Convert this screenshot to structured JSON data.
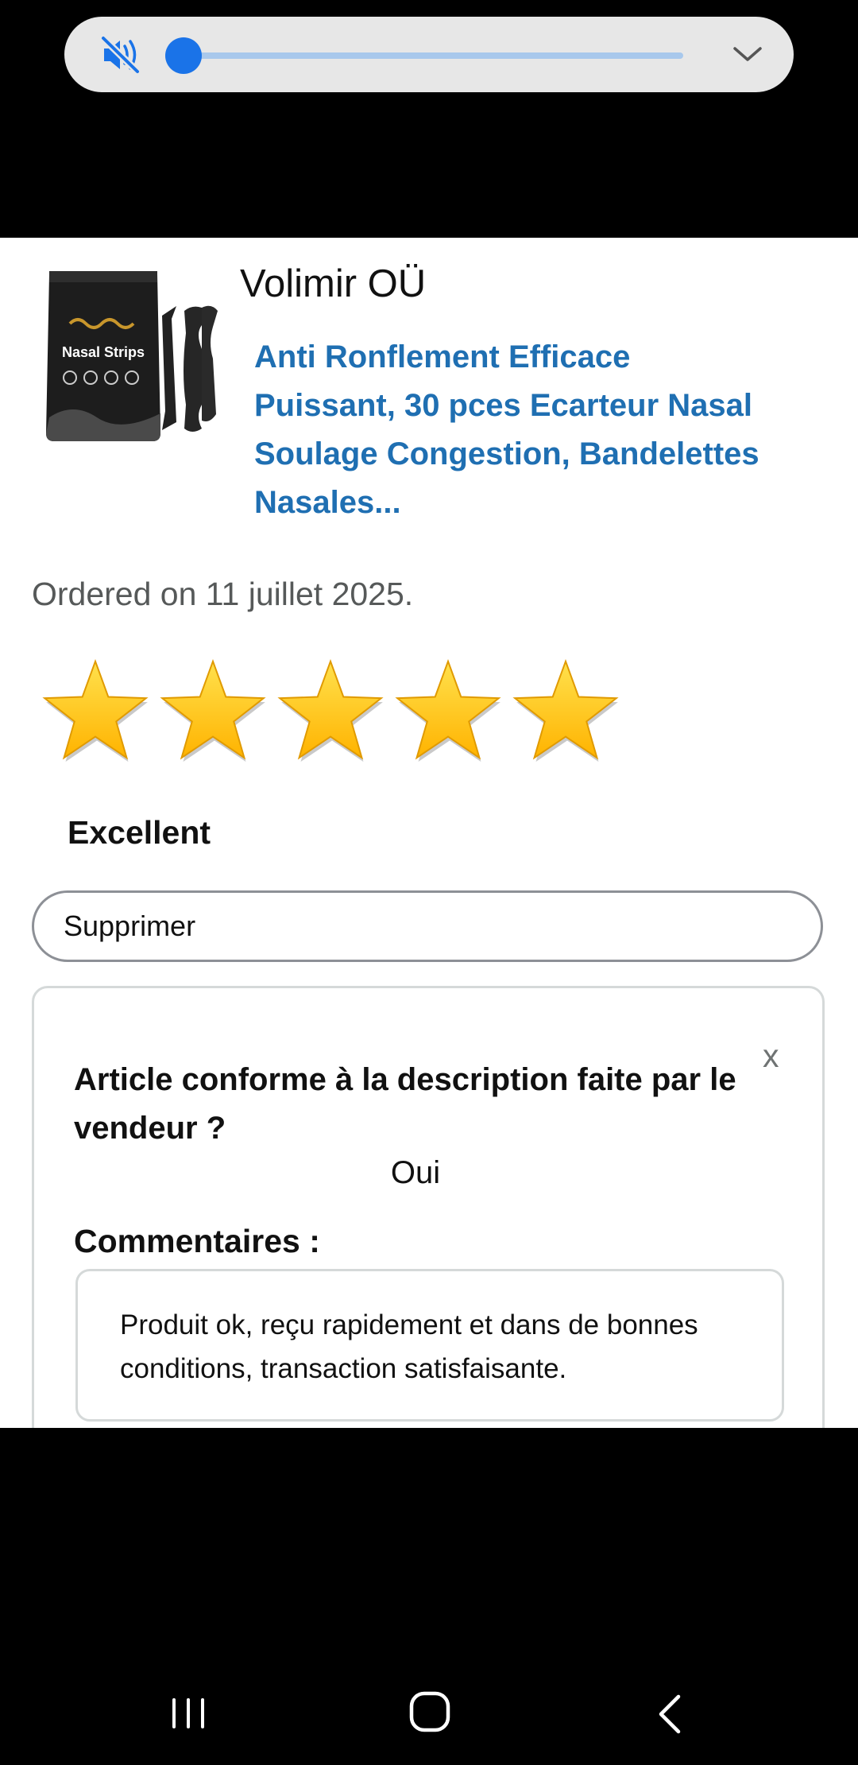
{
  "volume_panel": {
    "mute_icon": "volume-mute-icon",
    "level": 0.0,
    "expand_icon": "chevron-down-icon",
    "accent_color": "#1a73e8"
  },
  "product": {
    "seller": "Volimir OÜ",
    "image_text": "Nasal Strips",
    "title": "Anti Ronflement Efficace Puissant, 30 pces Ecarteur Nasal Soulage Congestion, Bandelettes Nasales...",
    "title_color": "#1f6fb2"
  },
  "order": {
    "date_text": "Ordered on 11 juillet 2025."
  },
  "rating": {
    "stars": 5,
    "max_stars": 5,
    "label": "Excellent",
    "star_color": "#ffb300"
  },
  "actions": {
    "delete_label": "Supprimer"
  },
  "feedback": {
    "close_label": "x",
    "question": "Article conforme à la description faite par le vendeur ?",
    "answer": "Oui",
    "comments_label": "Commentaires :",
    "comment_text": "Produit ok, reçu rapidement et dans de bonnes conditions, transaction satisfaisante."
  },
  "nav_bar": {
    "recents_icon": "recent-apps-icon",
    "home_icon": "home-icon",
    "back_icon": "back-icon"
  }
}
